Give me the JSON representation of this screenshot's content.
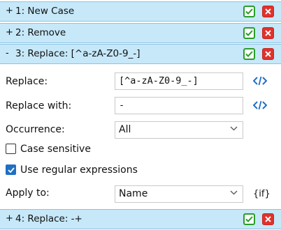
{
  "steps": [
    {
      "expander": "+",
      "title": "1: New Case"
    },
    {
      "expander": "+",
      "title": "2: Remove"
    },
    {
      "expander": "-",
      "title": "3: Replace: [^a-zA-Z0-9_-]"
    },
    {
      "expander": "+",
      "title": "4: Replace: -+"
    }
  ],
  "form": {
    "replace_label": "Replace:",
    "replace_value": "[^a-zA-Z0-9_-]",
    "replace_with_label": "Replace with:",
    "replace_with_value": "-",
    "occurrence_label": "Occurrence:",
    "occurrence_value": "All",
    "case_sensitive_label": "Case sensitive",
    "case_sensitive_checked": false,
    "regex_label": "Use regular expressions",
    "regex_checked": true,
    "apply_to_label": "Apply to:",
    "apply_to_value": "Name",
    "if_tag": "{if}"
  },
  "colors": {
    "header_bg": "#c6e8f9",
    "ok_green": "#2a9d2a",
    "delete_red": "#e0322b",
    "link_blue": "#1f6fc5"
  },
  "icons": {
    "expand": "plus-icon",
    "collapse": "minus-icon",
    "enable": "checkmark-icon",
    "delete": "close-icon",
    "code": "code-brackets-icon",
    "dropdown": "chevron-down-icon"
  }
}
